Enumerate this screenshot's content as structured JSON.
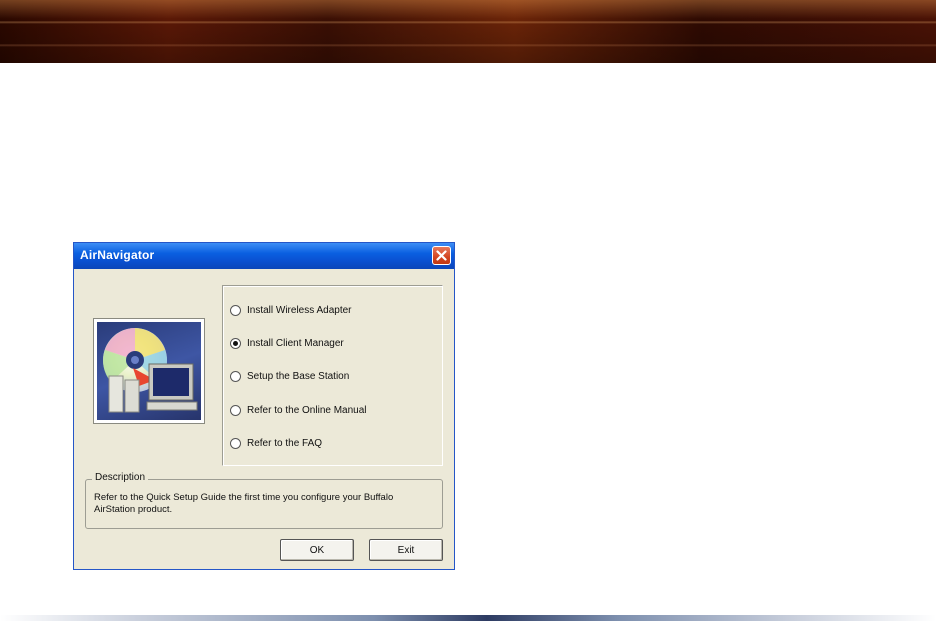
{
  "dialog": {
    "title": "AirNavigator",
    "options": [
      {
        "label": "Install Wireless Adapter",
        "selected": false
      },
      {
        "label": "Install Client Manager",
        "selected": true
      },
      {
        "label": "Setup the Base Station",
        "selected": false
      },
      {
        "label": "Refer to the Online Manual",
        "selected": false
      },
      {
        "label": "Refer to the FAQ",
        "selected": false
      }
    ],
    "description": {
      "legend": "Description",
      "text": "Refer to the Quick Setup Guide the first time you configure your Buffalo AirStation product."
    },
    "buttons": {
      "ok": "OK",
      "exit": "Exit"
    }
  },
  "colors": {
    "titlebar": "#0a5fe0",
    "dialog_bg": "#ece9d8",
    "close_button": "#d24521"
  }
}
